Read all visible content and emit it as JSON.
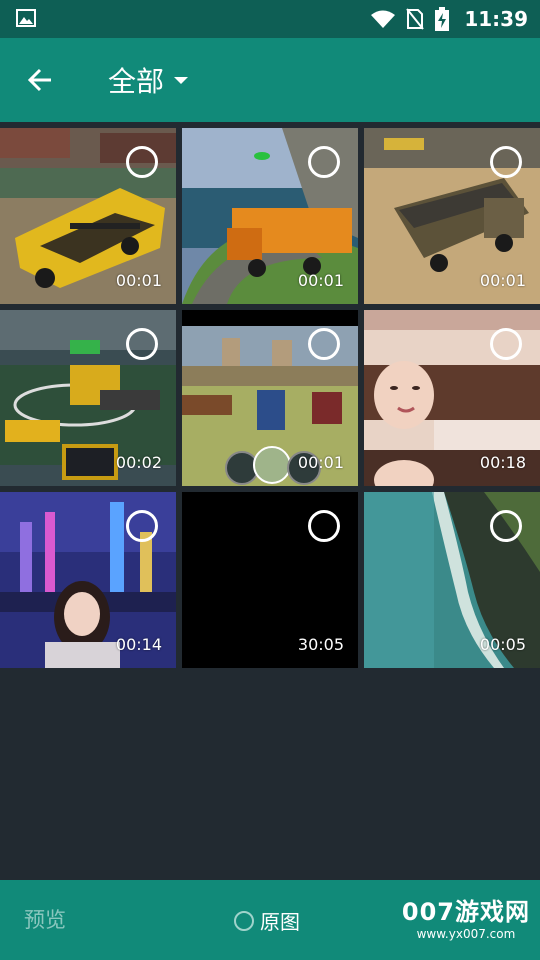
{
  "status_bar": {
    "time": "11:39",
    "icons": [
      "gallery-icon",
      "wifi-icon",
      "no-sim-icon",
      "battery-charging-icon"
    ]
  },
  "app_bar": {
    "title": "全部",
    "back_icon": "arrow-left-icon",
    "dropdown_icon": "caret-down-icon"
  },
  "videos": [
    {
      "duration": "00:01",
      "subject": "school bus game"
    },
    {
      "duration": "00:01",
      "subject": "dump truck mountain road"
    },
    {
      "duration": "00:01",
      "subject": "dump truck quarry"
    },
    {
      "duration": "00:02",
      "subject": "forklift parking taxis"
    },
    {
      "duration": "00:01",
      "subject": "trucks racing game"
    },
    {
      "duration": "00:18",
      "subject": "woman portrait"
    },
    {
      "duration": "00:14",
      "subject": "woman city night"
    },
    {
      "duration": "30:05",
      "subject": "black screen"
    },
    {
      "duration": "00:05",
      "subject": "coastline aerial"
    }
  ],
  "bottom_bar": {
    "preview_label": "预览",
    "original_label": "原图",
    "watermark_main": "007游戏网",
    "watermark_sub": "www.yx007.com"
  },
  "colors": {
    "status_bar": "#0e5f55",
    "app_bar": "#118a79",
    "background": "#222a31",
    "disabled_text": "#8ac7be"
  }
}
